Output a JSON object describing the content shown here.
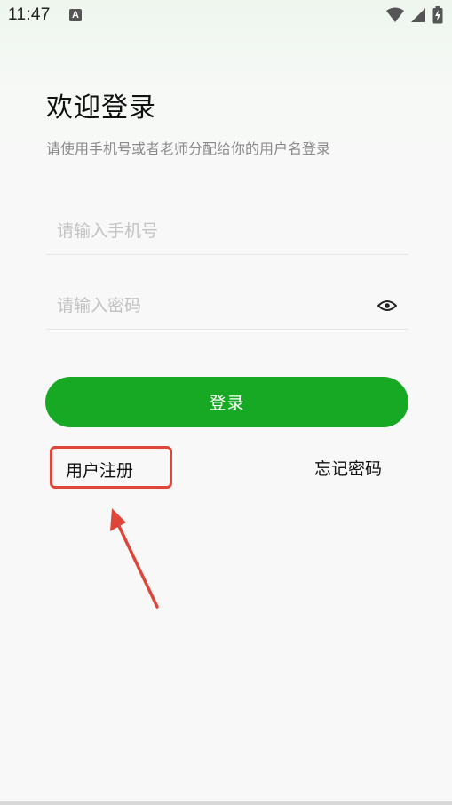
{
  "status_bar": {
    "time": "11:47",
    "notification_glyph": "A",
    "icons": [
      "wifi-icon",
      "signal-icon",
      "battery-charging-icon"
    ]
  },
  "login": {
    "title": "欢迎登录",
    "subtitle": "请使用手机号或者老师分配给你的用户名登录",
    "phone_placeholder": "请输入手机号",
    "phone_value": "",
    "password_placeholder": "请输入密码",
    "password_value": "",
    "password_toggle_icon": "eye-icon",
    "submit_label": "登录",
    "register_label": "用户注册",
    "forgot_label": "忘记密码"
  },
  "colors": {
    "primary": "#17a923",
    "annotation": "#e0453a",
    "placeholder": "#c2c2c2",
    "subtitle": "#8a8a8a"
  }
}
